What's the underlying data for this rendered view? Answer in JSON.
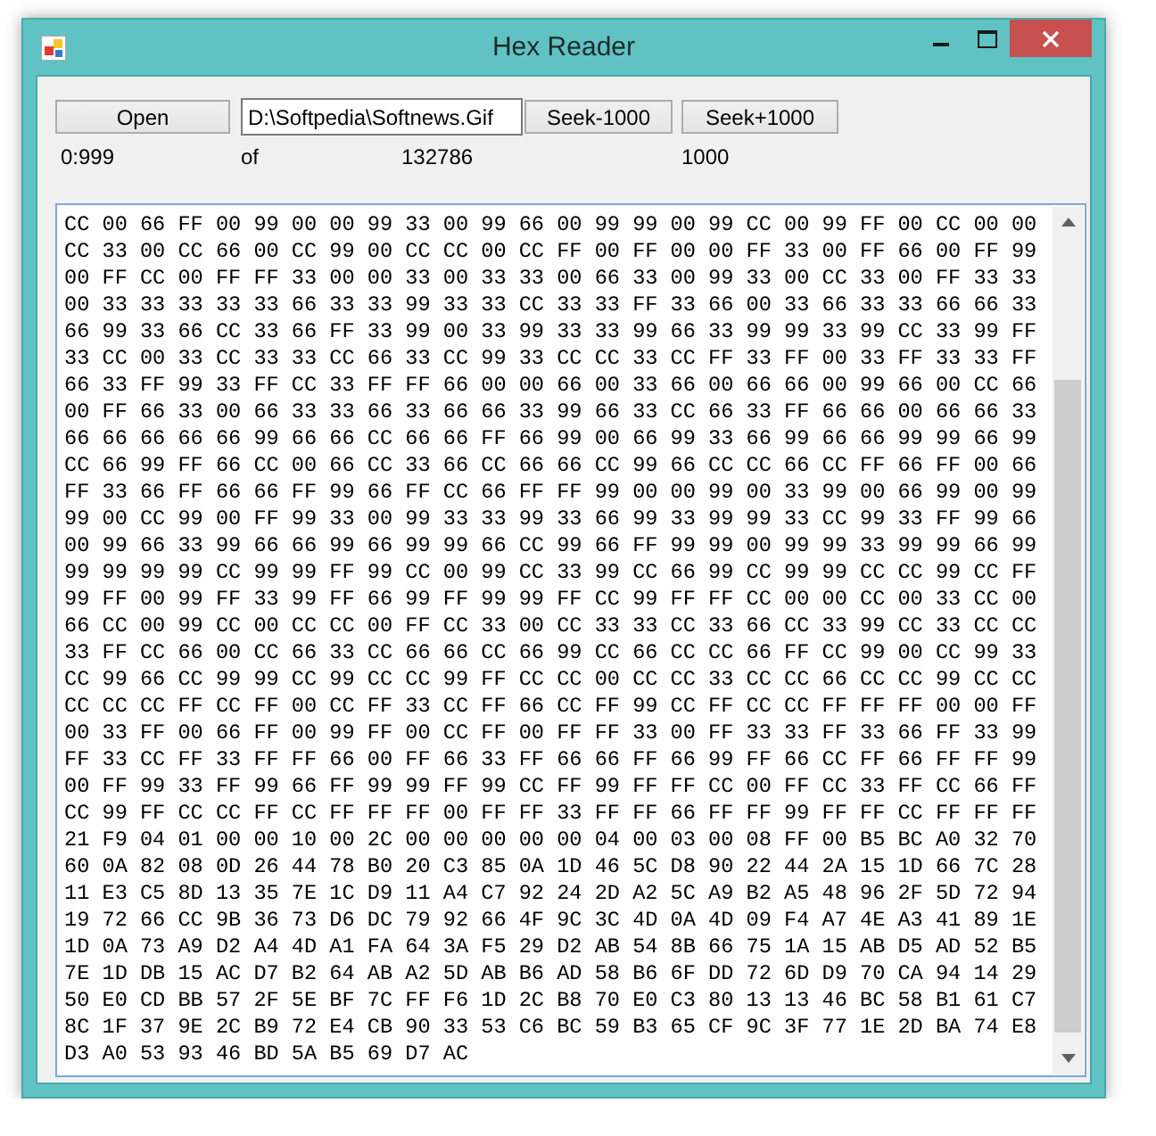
{
  "window": {
    "title": "Hex Reader"
  },
  "toolbar": {
    "open_button": "Open",
    "path": "D:\\Softpedia\\Softnews.Gif",
    "seek_back_button": "Seek-1000",
    "seek_forward_button": "Seek+1000"
  },
  "status": {
    "range": "0:999",
    "of": "of",
    "total": "132786",
    "step": "1000"
  },
  "hex_view": {
    "lines": [
      "CC 00 66 FF 00 99 00 00 99 33 00 99 66 00 99 99 00 99 CC 00 99 FF 00 CC 00 00",
      "CC 33 00 CC 66 00 CC 99 00 CC CC 00 CC FF 00 FF 00 00 FF 33 00 FF 66 00 FF 99",
      "00 FF CC 00 FF FF 33 00 00 33 00 33 33 00 66 33 00 99 33 00 CC 33 00 FF 33 33",
      "00 33 33 33 33 33 66 33 33 99 33 33 CC 33 33 FF 33 66 00 33 66 33 33 66 66 33",
      "66 99 33 66 CC 33 66 FF 33 99 00 33 99 33 33 99 66 33 99 99 33 99 CC 33 99 FF",
      "33 CC 00 33 CC 33 33 CC 66 33 CC 99 33 CC CC 33 CC FF 33 FF 00 33 FF 33 33 FF",
      "66 33 FF 99 33 FF CC 33 FF FF 66 00 00 66 00 33 66 00 66 66 00 99 66 00 CC 66",
      "00 FF 66 33 00 66 33 33 66 33 66 66 33 99 66 33 CC 66 33 FF 66 66 00 66 66 33",
      "66 66 66 66 66 99 66 66 CC 66 66 FF 66 99 00 66 99 33 66 99 66 66 99 99 66 99",
      "CC 66 99 FF 66 CC 00 66 CC 33 66 CC 66 66 CC 99 66 CC CC 66 CC FF 66 FF 00 66",
      "FF 33 66 FF 66 66 FF 99 66 FF CC 66 FF FF 99 00 00 99 00 33 99 00 66 99 00 99",
      "99 00 CC 99 00 FF 99 33 00 99 33 33 99 33 66 99 33 99 99 33 CC 99 33 FF 99 66",
      "00 99 66 33 99 66 66 99 66 99 99 66 CC 99 66 FF 99 99 00 99 99 33 99 99 66 99",
      "99 99 99 99 CC 99 99 FF 99 CC 00 99 CC 33 99 CC 66 99 CC 99 99 CC CC 99 CC FF",
      "99 FF 00 99 FF 33 99 FF 66 99 FF 99 99 FF CC 99 FF FF CC 00 00 CC 00 33 CC 00",
      "66 CC 00 99 CC 00 CC CC 00 FF CC 33 00 CC 33 33 CC 33 66 CC 33 99 CC 33 CC CC",
      "33 FF CC 66 00 CC 66 33 CC 66 66 CC 66 99 CC 66 CC CC 66 FF CC 99 00 CC 99 33",
      "CC 99 66 CC 99 99 CC 99 CC CC 99 FF CC CC 00 CC CC 33 CC CC 66 CC CC 99 CC CC",
      "CC CC CC FF CC FF 00 CC FF 33 CC FF 66 CC FF 99 CC FF CC CC FF FF FF 00 00 FF",
      "00 33 FF 00 66 FF 00 99 FF 00 CC FF 00 FF FF 33 00 FF 33 33 FF 33 66 FF 33 99",
      "FF 33 CC FF 33 FF FF 66 00 FF 66 33 FF 66 66 FF 66 99 FF 66 CC FF 66 FF FF 99",
      "00 FF 99 33 FF 99 66 FF 99 99 FF 99 CC FF 99 FF FF CC 00 FF CC 33 FF CC 66 FF",
      "CC 99 FF CC CC FF CC FF FF FF 00 FF FF 33 FF FF 66 FF FF 99 FF FF CC FF FF FF",
      "21 F9 04 01 00 00 10 00 2C 00 00 00 00 00 04 00 03 00 08 FF 00 B5 BC A0 32 70",
      "60 0A 82 08 0D 26 44 78 B0 20 C3 85 0A 1D 46 5C D8 90 22 44 2A 15 1D 66 7C 28",
      "11 E3 C5 8D 13 35 7E 1C D9 11 A4 C7 92 24 2D A2 5C A9 B2 A5 48 96 2F 5D 72 94",
      "19 72 66 CC 9B 36 73 D6 DC 79 92 66 4F 9C 3C 4D 0A 4D 09 F4 A7 4E A3 41 89 1E",
      "1D 0A 73 A9 D2 A4 4D A1 FA 64 3A F5 29 D2 AB 54 8B 66 75 1A 15 AB D5 AD 52 B5",
      "7E 1D DB 15 AC D7 B2 64 AB A2 5D AB B6 AD 58 B6 6F DD 72 6D D9 70 CA 94 14 29",
      "50 E0 CD BB 57 2F 5E BF 7C FF F6 1D 2C B8 70 E0 C3 80 13 13 46 BC 58 B1 61 C7",
      "8C 1F 37 9E 2C B9 72 E4 CB 90 33 53 C6 BC 59 B3 65 CF 9C 3F 77 1E 2D BA 74 E8",
      "D3 A0 53 93 46 BD 5A B5 69 D7 AC"
    ]
  }
}
